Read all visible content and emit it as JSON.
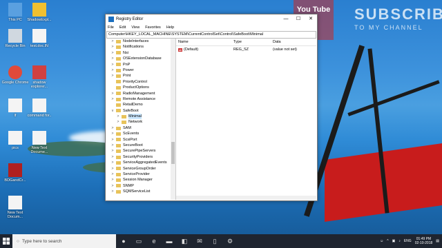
{
  "desktop": {
    "icons": [
      {
        "label": "This PC",
        "glyph": "computer-icon"
      },
      {
        "label": "ShadowExpl...",
        "glyph": "arrow-back-icon"
      },
      {
        "label": "Recycle Bin",
        "glyph": "recycle-bin-icon"
      },
      {
        "label": "test.doc.lN",
        "glyph": "document-icon"
      },
      {
        "label": "Google Chrome",
        "glyph": "chrome-icon"
      },
      {
        "label": "shadow explorer...",
        "glyph": "shield-icon"
      },
      {
        "label": "lf",
        "glyph": "document-icon"
      },
      {
        "label": "command for..",
        "glyph": "document-icon"
      },
      {
        "label": "pics",
        "glyph": "document-icon"
      },
      {
        "label": "New Text Docume...",
        "glyph": "document-icon"
      },
      {
        "label": "BDGandCr...",
        "glyph": "app-icon"
      },
      {
        "label": "New Text Docum...",
        "glyph": "document-icon"
      }
    ]
  },
  "youtube_overlay": {
    "logo": "You Tube",
    "line1": "SUBSCRIBE",
    "line2": "TO MY CHANNEL"
  },
  "window": {
    "title": "Registry Editor",
    "controls": {
      "minimize": "—",
      "maximize": "☐",
      "close": "✕"
    },
    "menu": [
      "File",
      "Edit",
      "View",
      "Favorites",
      "Help"
    ],
    "address": "Computer\\HKEY_LOCAL_MACHINE\\SYSTEM\\CurrentControlSet\\Control\\SafeBoot\\Minimal",
    "tree": [
      {
        "label": "NodeInterfaces",
        "indent": 0,
        "expander": ">"
      },
      {
        "label": "Notifications",
        "indent": 0,
        "expander": ">"
      },
      {
        "label": "Nsi",
        "indent": 0,
        "expander": ">"
      },
      {
        "label": "OSExtensionDatabase",
        "indent": 0,
        "expander": ">"
      },
      {
        "label": "PnP",
        "indent": 0,
        "expander": ">"
      },
      {
        "label": "Power",
        "indent": 0,
        "expander": ">"
      },
      {
        "label": "Print",
        "indent": 0,
        "expander": ">"
      },
      {
        "label": "PriorityControl",
        "indent": 0,
        "expander": ""
      },
      {
        "label": "ProductOptions",
        "indent": 0,
        "expander": ""
      },
      {
        "label": "RadioManagement",
        "indent": 0,
        "expander": ">"
      },
      {
        "label": "Remote Assistance",
        "indent": 0,
        "expander": ">"
      },
      {
        "label": "RetailDemo",
        "indent": 0,
        "expander": ""
      },
      {
        "label": "SafeBoot",
        "indent": 0,
        "expander": "v"
      },
      {
        "label": "Minimal",
        "indent": 1,
        "expander": ">",
        "selected": true
      },
      {
        "label": "Network",
        "indent": 1,
        "expander": ">"
      },
      {
        "label": "SAM",
        "indent": 0,
        "expander": ">"
      },
      {
        "label": "ScEvents",
        "indent": 0,
        "expander": ">"
      },
      {
        "label": "ScsiPort",
        "indent": 0,
        "expander": ">"
      },
      {
        "label": "SecureBoot",
        "indent": 0,
        "expander": ">"
      },
      {
        "label": "SecurePipeServers",
        "indent": 0,
        "expander": ">"
      },
      {
        "label": "SecurityProviders",
        "indent": 0,
        "expander": ">"
      },
      {
        "label": "ServiceAggregatedEvents",
        "indent": 0,
        "expander": ">"
      },
      {
        "label": "ServiceGroupOrder",
        "indent": 0,
        "expander": ">"
      },
      {
        "label": "ServiceProvider",
        "indent": 0,
        "expander": ">"
      },
      {
        "label": "Session Manager",
        "indent": 0,
        "expander": ">"
      },
      {
        "label": "SNMP",
        "indent": 0,
        "expander": ">"
      },
      {
        "label": "SQMServiceList",
        "indent": 0,
        "expander": ">"
      }
    ],
    "values_header": {
      "name": "Name",
      "type": "Type",
      "data": "Data"
    },
    "values": [
      {
        "name": "(Default)",
        "type": "REG_SZ",
        "data": "(value not set)",
        "icon": "ab"
      }
    ]
  },
  "taskbar": {
    "search_placeholder": "Type here to search",
    "apps": [
      "task-view-icon",
      "edge-icon",
      "file-explorer-icon",
      "store-icon",
      "mail-icon",
      "tablet-icon",
      "registry-icon"
    ],
    "tray": {
      "language": "ENG",
      "time": "01:49 PM",
      "date": "02-10-2018"
    }
  },
  "colors": {
    "selection": "#cce8ff",
    "taskbar": "#1f2530",
    "folder": "#e8c35a",
    "wing": "#c81c1c"
  }
}
